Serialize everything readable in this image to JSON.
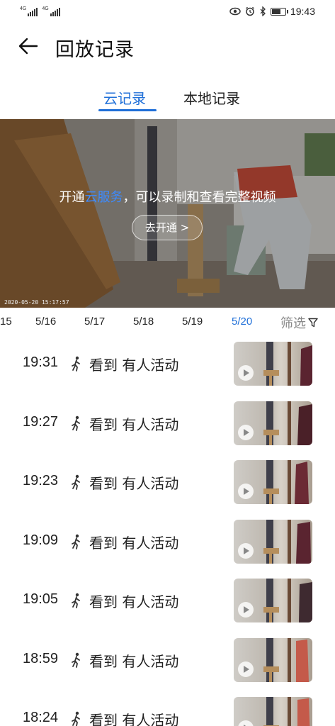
{
  "status_bar": {
    "signal_1": "4G",
    "signal_2": "4G",
    "icons": [
      "eye-icon",
      "alarm-icon",
      "bluetooth-icon",
      "battery-icon"
    ],
    "time": "19:43"
  },
  "header": {
    "title": "回放记录"
  },
  "tabs": {
    "cloud": "云记录",
    "local": "本地记录"
  },
  "video": {
    "msg_prefix": "开通",
    "msg_link": "云服务",
    "msg_suffix": "，可以录制和查看完整视频",
    "button": "去开通 >",
    "timestamp": "2020-05-20  15:17:57"
  },
  "dates": [
    "15",
    "5/16",
    "5/17",
    "5/18",
    "5/19",
    "5/20"
  ],
  "active_date": "5/20",
  "filter_label": "筛选",
  "events": [
    {
      "time": "19:31",
      "desc": "看到 有人活动"
    },
    {
      "time": "19:27",
      "desc": "看到 有人活动"
    },
    {
      "time": "19:23",
      "desc": "看到 有人活动"
    },
    {
      "time": "19:09",
      "desc": "看到 有人活动"
    },
    {
      "time": "19:05",
      "desc": "看到 有人活动"
    },
    {
      "time": "18:59",
      "desc": "看到 有人活动"
    },
    {
      "time": "18:24",
      "desc": "看到 有人活动"
    }
  ],
  "colors": {
    "accent": "#1f6fd8",
    "link": "#3d8bff"
  }
}
